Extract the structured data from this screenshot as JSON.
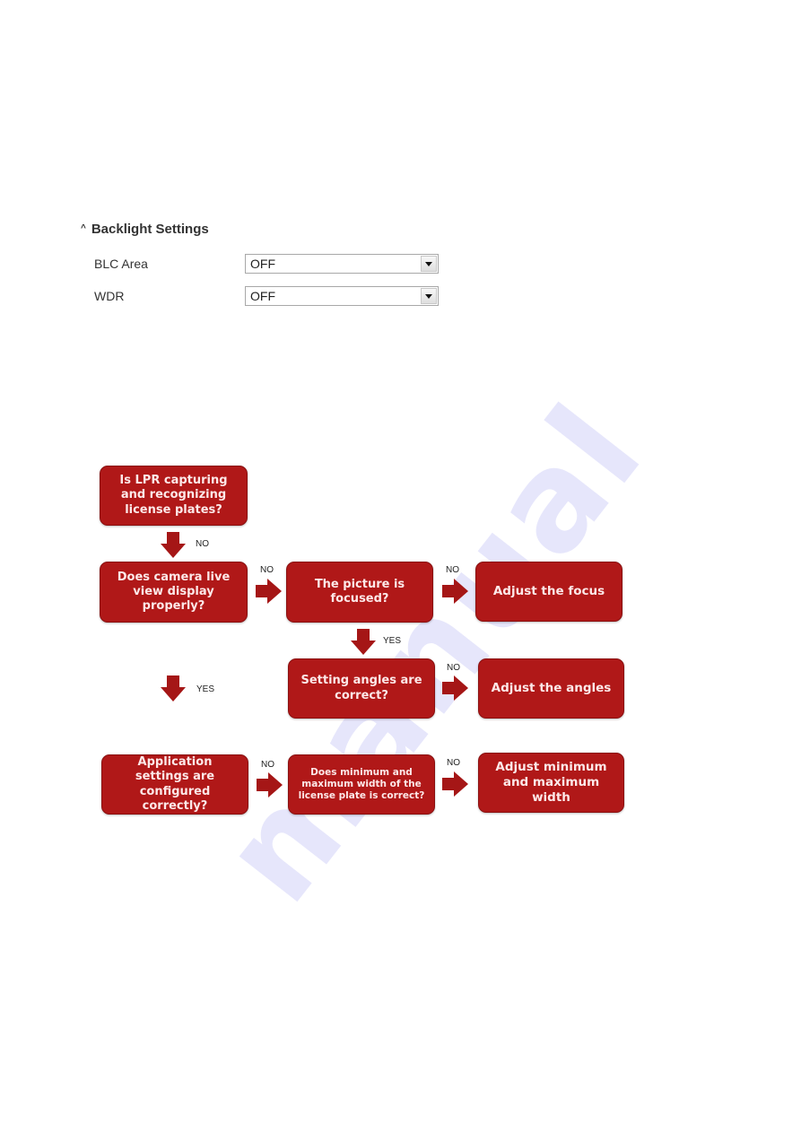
{
  "settings_panel": {
    "section_title": "Backlight Settings",
    "fields": [
      {
        "label": "BLC Area",
        "value": "OFF"
      },
      {
        "label": "WDR",
        "value": "OFF"
      }
    ]
  },
  "flowchart": {
    "colors": {
      "box": "#b01818",
      "box_text": "#fde8e8",
      "arrow": "#a51616"
    },
    "nodes": {
      "start": "Is LPR capturing and recognizing license plates?",
      "live_view": "Does camera live view display properly?",
      "focused": "The picture is focused?",
      "adjust_focus": "Adjust the focus",
      "angles_correct": "Setting angles are correct?",
      "adjust_angles": "Adjust the angles",
      "app_settings": "Application settings are configured correctly?",
      "width_correct": "Does minimum and maximum width of the license plate is correct?",
      "adjust_width": "Adjust minimum and maximum width"
    },
    "edge_labels": {
      "start_to_live_view": "NO",
      "live_view_to_focused": "NO",
      "focused_to_adjust_focus": "NO",
      "focused_to_angles": "YES",
      "angles_to_adjust_angles": "NO",
      "live_view_to_app_settings": "YES",
      "app_settings_to_width": "NO",
      "width_to_adjust_width": "NO"
    }
  },
  "watermark": "manual"
}
